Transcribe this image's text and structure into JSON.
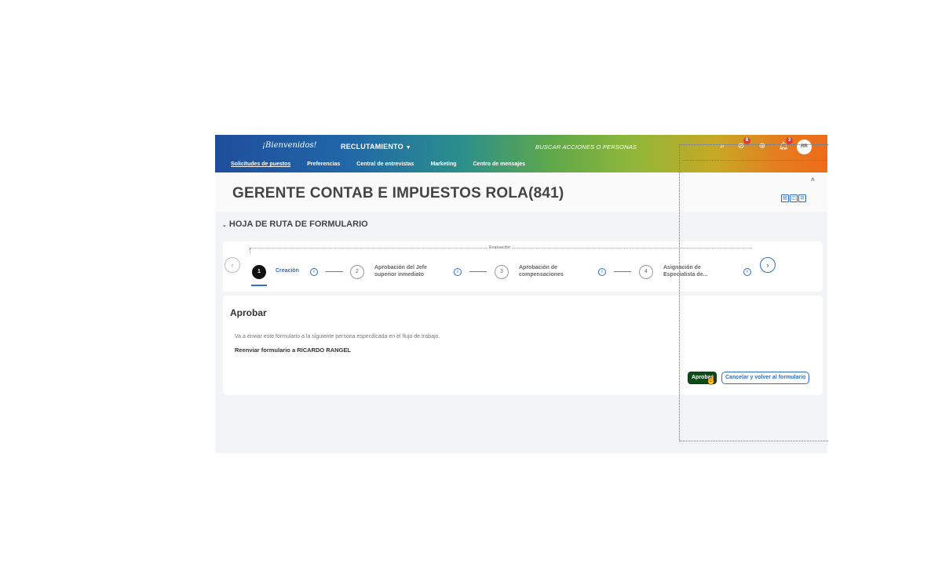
{
  "header": {
    "logo": "¡Bienvenidos!",
    "module": "RECLUTAMIENTO",
    "search_placeholder": "BUSCAR ACCIONES O PERSONAS",
    "notif_badges": {
      "approvals": "8",
      "alerts": "3"
    },
    "avatar_initials": "RR"
  },
  "subnav": {
    "items": [
      "Solicitudes de puestos",
      "Preferencias",
      "Central de entrevistas",
      "Marketing",
      "Centro de mensajes"
    ]
  },
  "page": {
    "title": "GERENTE CONTAB E IMPUESTOS ROLA(841)"
  },
  "route_map": {
    "section_title": "HOJA DE RUTA DE FORMULARIO",
    "phase_label": "Evaluación",
    "steps": [
      {
        "num": "1",
        "label": "Creación",
        "line2": ""
      },
      {
        "num": "2",
        "label": "Aprobación del Jefe",
        "line2": "superior inmediato"
      },
      {
        "num": "3",
        "label": "Aprobación de",
        "line2": "compensaciones"
      },
      {
        "num": "4",
        "label": "Asignación de",
        "line2": "Especialista de..."
      }
    ],
    "active_step": 1
  },
  "approve": {
    "title": "Aprobar",
    "message": "Va a enviar este formulario a la siguiente persona especificada en el flujo de trabajo.",
    "forward_text": "Reenviar formulario a RICARDO RANGEL",
    "approve_button": "Aprobar",
    "cancel_button": "Cancelar y volver al formulario"
  },
  "colors": {
    "accent": "#2e6fbf",
    "approve_button": "#0e4b18",
    "badge": "#e03a3a"
  }
}
